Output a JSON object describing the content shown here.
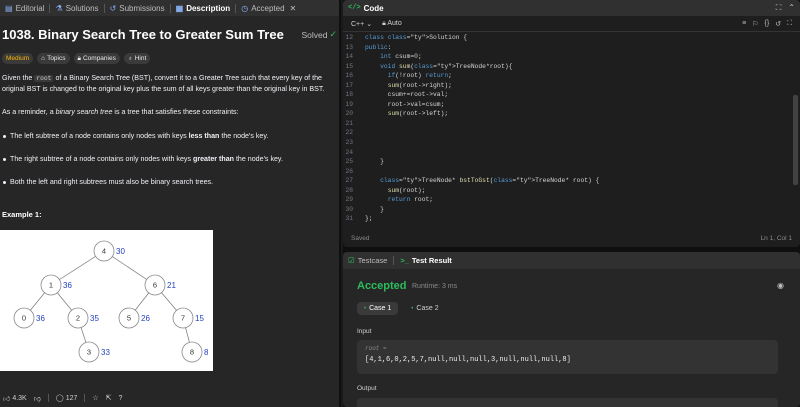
{
  "problem_tabs": [
    {
      "label": "Editorial",
      "icon": "book-icon"
    },
    {
      "label": "Solutions",
      "icon": "flask-icon"
    },
    {
      "label": "Submissions",
      "icon": "history-icon"
    },
    {
      "label": "Description",
      "icon": "document-icon"
    },
    {
      "label": "Accepted",
      "icon": "clock-icon"
    }
  ],
  "problem": {
    "title": "1038. Binary Search Tree to Greater Sum Tree",
    "status": "Solved",
    "difficulty": "Medium",
    "chips": [
      "Topics",
      "Companies",
      "Hint"
    ],
    "desc_p1_a": "Given the ",
    "desc_code": "root",
    "desc_p1_b": " of a Binary Search Tree (BST), convert it to a Greater Tree such that every key of the original BST is changed to the original key plus the sum of all keys greater than the original key in BST.",
    "desc_p2_a": "As a reminder, a ",
    "desc_p2_em": "binary search tree",
    "desc_p2_b": " is a tree that satisfies these constraints:",
    "bullet1_a": "The left subtree of a node contains only nodes with keys ",
    "bullet1_b": "less than",
    "bullet1_c": " the node's key.",
    "bullet2_a": "The right subtree of a node contains only nodes with keys ",
    "bullet2_b": "greater than",
    "bullet2_c": " the node's key.",
    "bullet3": "Both the left and right subtrees must also be binary search trees.",
    "example_title": "Example 1:"
  },
  "tree": {
    "nodes": [
      {
        "key": "4",
        "sum": "30"
      },
      {
        "key": "1",
        "sum": "36"
      },
      {
        "key": "6",
        "sum": "21"
      },
      {
        "key": "0",
        "sum": "36"
      },
      {
        "key": "2",
        "sum": "35"
      },
      {
        "key": "5",
        "sum": "26"
      },
      {
        "key": "7",
        "sum": "15"
      },
      {
        "key": "3",
        "sum": "33"
      },
      {
        "key": "8",
        "sum": "8"
      }
    ],
    "sum_color": "#1f3fbf"
  },
  "bottom_bar": {
    "likes": "4.3K",
    "comments": "127"
  },
  "code_panel": {
    "title": "Code",
    "language": "C++",
    "mode": "Auto",
    "status": "Saved",
    "cursor": "Ln 1, Col 1"
  },
  "code_lines": [
    {
      "n": "12",
      "t": "class Solution {"
    },
    {
      "n": "13",
      "t": "public:"
    },
    {
      "n": "14",
      "t": "    int csum=0;"
    },
    {
      "n": "15",
      "t": "    void sum(TreeNode*root){"
    },
    {
      "n": "16",
      "t": "      if(!root) return;"
    },
    {
      "n": "17",
      "t": "      sum(root->right);"
    },
    {
      "n": "18",
      "t": "      csum+=root->val;"
    },
    {
      "n": "19",
      "t": "      root->val=csum;"
    },
    {
      "n": "20",
      "t": "      sum(root->left);"
    },
    {
      "n": "21",
      "t": ""
    },
    {
      "n": "22",
      "t": ""
    },
    {
      "n": "23",
      "t": ""
    },
    {
      "n": "24",
      "t": ""
    },
    {
      "n": "25",
      "t": "    }"
    },
    {
      "n": "26",
      "t": ""
    },
    {
      "n": "27",
      "t": "    TreeNode* bstToGst(TreeNode* root) {"
    },
    {
      "n": "28",
      "t": "      sum(root);"
    },
    {
      "n": "29",
      "t": "      return root;"
    },
    {
      "n": "30",
      "t": "    }"
    },
    {
      "n": "31",
      "t": "};"
    }
  ],
  "result": {
    "tab_testcase": "Testcase",
    "tab_result": "Test Result",
    "verdict": "Accepted",
    "runtime": "Runtime: 3 ms",
    "cases": [
      "Case 1",
      "Case 2"
    ],
    "input_label": "Input",
    "input_var": "root =",
    "input_value": "[4,1,6,0,2,5,7,null,null,null,3,null,null,null,8]",
    "output_label": "Output"
  },
  "colors": {
    "accent_green": "#2cbb5d",
    "difficulty_medium": "#ffb800"
  }
}
